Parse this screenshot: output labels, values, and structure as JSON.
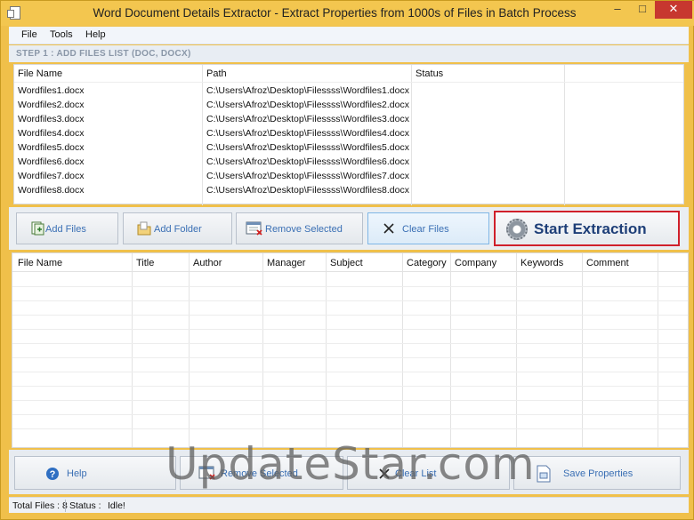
{
  "window": {
    "title": "Word Document Details Extractor - Extract Properties from 1000s of Files in Batch Process",
    "min_glyph": "–",
    "max_glyph": "□",
    "close_glyph": "✕"
  },
  "menu": [
    "File",
    "Tools",
    "Help"
  ],
  "step1_label": "STEP 1 : ADD FILES LIST (DOC, DOCX)",
  "files_table": {
    "headers": [
      "File Name",
      "Path",
      "Status"
    ],
    "rows": [
      {
        "name": "Wordfiles1.docx",
        "path": "C:\\Users\\Afroz\\Desktop\\Filessss\\Wordfiles1.docx",
        "status": ""
      },
      {
        "name": "Wordfiles2.docx",
        "path": "C:\\Users\\Afroz\\Desktop\\Filessss\\Wordfiles2.docx",
        "status": ""
      },
      {
        "name": "Wordfiles3.docx",
        "path": "C:\\Users\\Afroz\\Desktop\\Filessss\\Wordfiles3.docx",
        "status": ""
      },
      {
        "name": "Wordfiles4.docx",
        "path": "C:\\Users\\Afroz\\Desktop\\Filessss\\Wordfiles4.docx",
        "status": ""
      },
      {
        "name": "Wordfiles5.docx",
        "path": "C:\\Users\\Afroz\\Desktop\\Filessss\\Wordfiles5.docx",
        "status": ""
      },
      {
        "name": "Wordfiles6.docx",
        "path": "C:\\Users\\Afroz\\Desktop\\Filessss\\Wordfiles6.docx",
        "status": ""
      },
      {
        "name": "Wordfiles7.docx",
        "path": "C:\\Users\\Afroz\\Desktop\\Filessss\\Wordfiles7.docx",
        "status": ""
      },
      {
        "name": "Wordfiles8.docx",
        "path": "C:\\Users\\Afroz\\Desktop\\Filessss\\Wordfiles8.docx",
        "status": ""
      }
    ]
  },
  "toolbar": {
    "add_files": "Add Files",
    "add_folder": "Add Folder",
    "remove_selected": "Remove Selected",
    "clear_files": "Clear Files",
    "start_extraction": "Start Extraction"
  },
  "results_table": {
    "headers": [
      "File Name",
      "Title",
      "Author",
      "Manager",
      "Subject",
      "Category",
      "Company",
      "Keywords",
      "Comment"
    ]
  },
  "bottom_buttons": {
    "help": "Help",
    "remove_selected": "Remove Selected",
    "clear_list": "Clear List",
    "save_properties": "Save Properties"
  },
  "status": {
    "total_files": "Total Files : 8",
    "status_label": "Status :",
    "status_value": "Idle!"
  },
  "watermark": "UpdateStar.com",
  "colors": {
    "frame": "#f0c04a",
    "accent_text": "#3a6fb4",
    "highlight_border": "#d0202a",
    "close_button": "#c7372f"
  }
}
